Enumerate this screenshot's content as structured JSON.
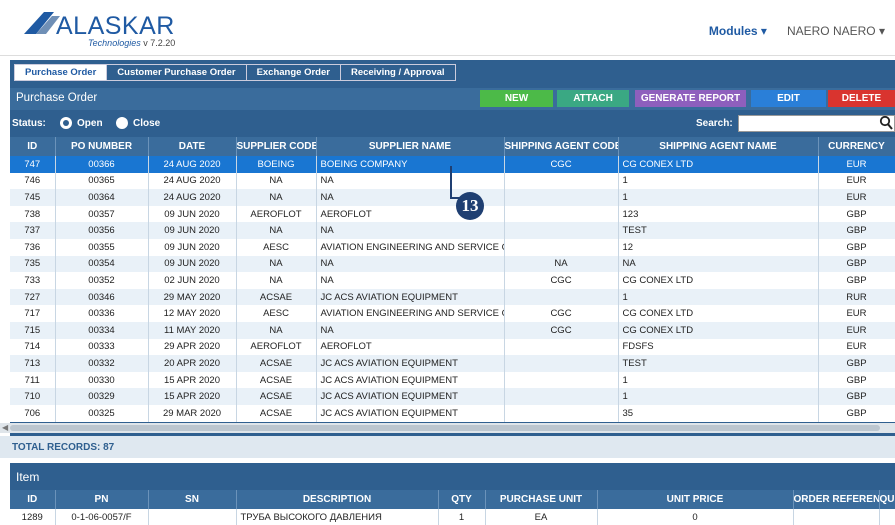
{
  "brand": {
    "name": "ALASKAR",
    "sub": "Technologies",
    "version": "v 7.2.20"
  },
  "top_nav": {
    "modules": "Modules ▾",
    "user": "NAERO NAERO ▾"
  },
  "tabs": [
    "Purchase Order",
    "Customer Purchase Order",
    "Exchange Order",
    "Receiving / Approval"
  ],
  "title": "Purchase Order",
  "actions": {
    "new": "NEW",
    "attach": "ATTACH",
    "report": "GENERATE REPORT",
    "edit": "EDIT",
    "delete": "DELETE"
  },
  "status": {
    "label": "Status:",
    "open": "Open",
    "close": "Close",
    "search_label": "Search:",
    "search_value": ""
  },
  "columns": [
    "ID",
    "PO NUMBER",
    "DATE",
    "SUPPLIER CODE",
    "SUPPLIER NAME",
    "SHIPPING AGENT CODE",
    "SHIPPING AGENT NAME",
    "CURRENCY"
  ],
  "rows": [
    [
      "747",
      "00366",
      "24 AUG 2020",
      "BOEING",
      "BOEING COMPANY",
      "CGC",
      "CG CONEX LTD",
      "EUR"
    ],
    [
      "746",
      "00365",
      "24 AUG 2020",
      "NA",
      "NA",
      "",
      "1",
      "EUR"
    ],
    [
      "745",
      "00364",
      "24 AUG 2020",
      "NA",
      "NA",
      "",
      "1",
      "EUR"
    ],
    [
      "738",
      "00357",
      "09 JUN 2020",
      "AEROFLOT",
      "AEROFLOT",
      "",
      "123",
      "GBP"
    ],
    [
      "737",
      "00356",
      "09 JUN 2020",
      "NA",
      "NA",
      "",
      "TEST",
      "GBP"
    ],
    [
      "736",
      "00355",
      "09 JUN 2020",
      "AESC",
      "AVIATION ENGINEERING AND SERVICE CC",
      "",
      "12",
      "GBP"
    ],
    [
      "735",
      "00354",
      "09 JUN 2020",
      "NA",
      "NA",
      "NA",
      "NA",
      "GBP"
    ],
    [
      "733",
      "00352",
      "02 JUN 2020",
      "NA",
      "NA",
      "CGC",
      "CG CONEX LTD",
      "GBP"
    ],
    [
      "727",
      "00346",
      "29 MAY 2020",
      "ACSAE",
      "JC ACS AVIATION EQUIPMENT",
      "",
      "1",
      "RUR"
    ],
    [
      "717",
      "00336",
      "12 MAY 2020",
      "AESC",
      "AVIATION ENGINEERING AND SERVICE CC",
      "CGC",
      "CG CONEX LTD",
      "EUR"
    ],
    [
      "715",
      "00334",
      "11 MAY 2020",
      "NA",
      "NA",
      "CGC",
      "CG CONEX LTD",
      "EUR"
    ],
    [
      "714",
      "00333",
      "29 APR 2020",
      "AEROFLOT",
      "AEROFLOT",
      "",
      "FDSFS",
      "EUR"
    ],
    [
      "713",
      "00332",
      "20 APR 2020",
      "ACSAE",
      "JC ACS AVIATION EQUIPMENT",
      "",
      "TEST",
      "GBP"
    ],
    [
      "711",
      "00330",
      "15 APR 2020",
      "ACSAE",
      "JC ACS AVIATION EQUIPMENT",
      "",
      "1",
      "GBP"
    ],
    [
      "710",
      "00329",
      "15 APR 2020",
      "ACSAE",
      "JC ACS AVIATION EQUIPMENT",
      "",
      "1",
      "GBP"
    ],
    [
      "706",
      "00325",
      "29 MAR 2020",
      "ACSAE",
      "JC ACS AVIATION EQUIPMENT",
      "",
      "35",
      "GBP"
    ]
  ],
  "total_records": "TOTAL RECORDS: 87",
  "item": {
    "title": "Item",
    "columns": [
      "ID",
      "PN",
      "SN",
      "DESCRIPTION",
      "QTY",
      "PURCHASE UNIT",
      "UNIT PRICE",
      "ORDER REFERENCE",
      "QU"
    ],
    "rows": [
      [
        "1289",
        "0-1-06-0057/F",
        "",
        "ТРУБА ВЫСОКОГО ДАВЛЕНИЯ",
        "1",
        "EA",
        "0",
        "",
        ""
      ]
    ]
  },
  "callout": "13"
}
